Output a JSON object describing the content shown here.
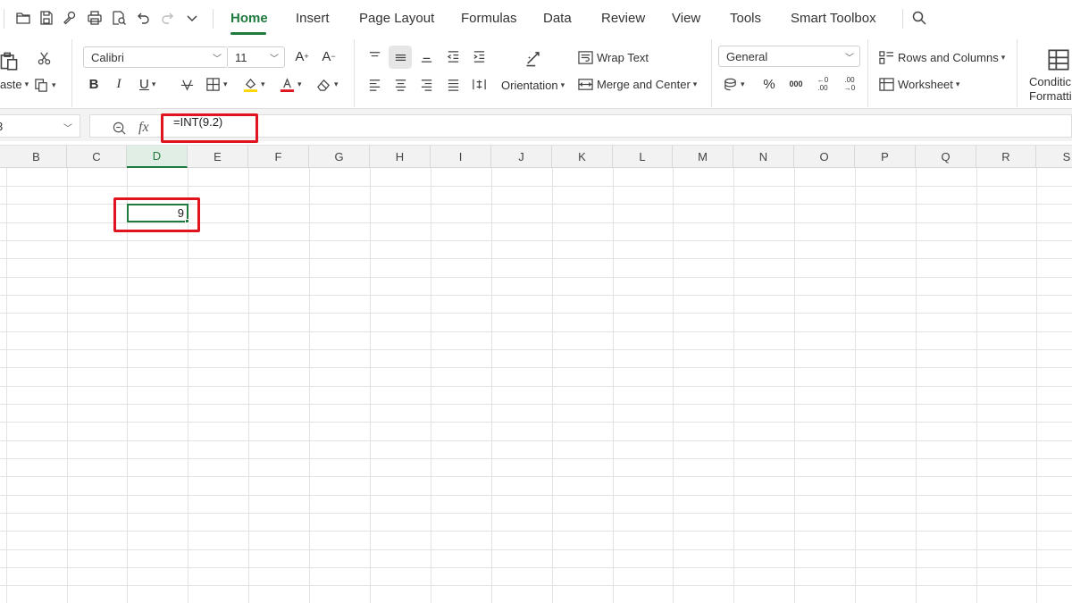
{
  "menu": {
    "tabs": [
      "Home",
      "Insert",
      "Page Layout",
      "Formulas",
      "Data",
      "Review",
      "View",
      "Tools",
      "Smart Toolbox"
    ],
    "active_tab": "Home"
  },
  "ribbon": {
    "clipboard": {
      "paste_label": "aste"
    },
    "font": {
      "name": "Calibri",
      "size": "11",
      "bold": "B",
      "italic": "I",
      "underline": "U"
    },
    "alignment": {
      "orientation_label": "Orientation",
      "wrap_text_label": "Wrap Text",
      "merge_label": "Merge and Center"
    },
    "number": {
      "format": "General"
    },
    "cells": {
      "rows_columns_label": "Rows and Columns",
      "worksheet_label": "Worksheet"
    },
    "styles": {
      "conditional_label_1": "Conditic",
      "conditional_label_2": "Formatti"
    }
  },
  "formula_bar": {
    "name_box": "3",
    "fx_label": "fx",
    "formula": "=INT(9.2)"
  },
  "grid": {
    "columns": [
      "B",
      "C",
      "D",
      "E",
      "F",
      "G",
      "H",
      "I",
      "J",
      "K",
      "L",
      "M",
      "N",
      "O",
      "P",
      "Q",
      "R",
      "S"
    ],
    "selected_column": "D",
    "active_cell_value": "9"
  },
  "colors": {
    "accent": "#1f7a3e",
    "highlight_box": "#e0141e",
    "highlight_fill": "#ffd600",
    "font_color": "#e0141e"
  }
}
